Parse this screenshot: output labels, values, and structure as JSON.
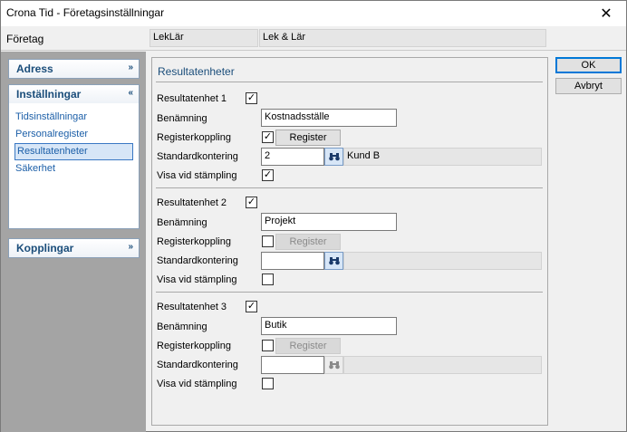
{
  "window": {
    "title": "Crona Tid - Företagsinställningar",
    "close_glyph": "✕"
  },
  "company": {
    "label": "Företag",
    "code": "LekLär",
    "name": "Lek & Lär"
  },
  "sidebar": {
    "groups": [
      {
        "label": "Adress",
        "chevron": "»"
      },
      {
        "label": "Inställningar",
        "chevron": "«",
        "items": [
          "Tidsinställningar",
          "Personalregister",
          "Resultatenheter",
          "Säkerhet"
        ],
        "selected": "Resultatenheter"
      },
      {
        "label": "Kopplingar",
        "chevron": "»"
      }
    ]
  },
  "main": {
    "heading": "Resultatenheter",
    "labels": {
      "naming": "Benämning",
      "register_link": "Registerkoppling",
      "default_account": "Standardkontering",
      "show_on_punch": "Visa vid stämpling",
      "register_button": "Register"
    },
    "units": [
      {
        "title": "Resultatenhet 1",
        "enabled": "✓",
        "name": "Kostnadsställe",
        "register": "✓",
        "account": "2",
        "account_name": "Kund B",
        "show": "✓"
      },
      {
        "title": "Resultatenhet 2",
        "enabled": "✓",
        "name": "Projekt",
        "register": "",
        "account": "",
        "account_name": "",
        "show": ""
      },
      {
        "title": "Resultatenhet 3",
        "enabled": "✓",
        "name": "Butik",
        "register": "",
        "account": "",
        "account_name": "",
        "show": ""
      }
    ]
  },
  "buttons": {
    "ok": "OK",
    "cancel": "Avbryt"
  },
  "colors": {
    "accent": "#1a4d7a",
    "link": "#1c5fa8",
    "selection_border": "#3a78c3",
    "sidebar_bg": "#a4a4a4"
  }
}
